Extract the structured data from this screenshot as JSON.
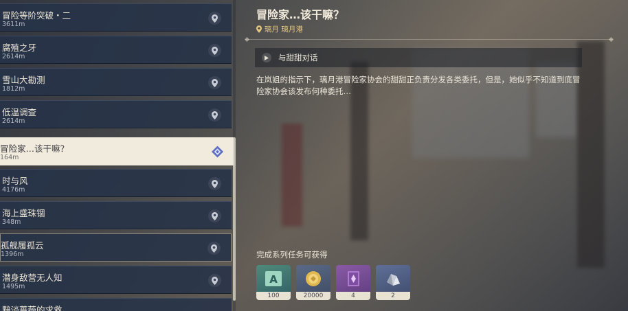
{
  "quests": [
    {
      "name": "冒险等阶突破・二",
      "distance": "3611m"
    },
    {
      "name": "腐殖之牙",
      "distance": "2614m"
    },
    {
      "name": "雪山大勘测",
      "distance": "1812m"
    },
    {
      "name": "低温调查",
      "distance": "2614m"
    },
    {
      "name": "冒险家…该干嘛？",
      "distance": "164m"
    },
    {
      "name": "时与风",
      "distance": "4176m"
    },
    {
      "name": "海上盛珠锢",
      "distance": "348m"
    },
    {
      "name": "孤舰履孤云",
      "distance": "1396m"
    },
    {
      "name": "潜身敌营无人知",
      "distance": "1495m"
    },
    {
      "name": "黯淡蔷薇的求救",
      "distance": ""
    }
  ],
  "detail": {
    "title": "冒险家…该干嘛？",
    "location": "璃月 璃月港",
    "step": "与甜甜对话",
    "description": "在岚姐的指示下，璃月港冒险家协会的甜甜正负责分发各类委托，但是，她似乎不知道到底冒险家协会该发布何种委托…",
    "rewards_title": "完成系列任务可获得",
    "rewards": [
      {
        "icon": "adventure-exp-icon",
        "count": "100"
      },
      {
        "icon": "mora-coin-icon",
        "count": "20000"
      },
      {
        "icon": "heros-wit-book-icon",
        "count": "4"
      },
      {
        "icon": "enhancement-ore-icon",
        "count": "2"
      }
    ]
  },
  "colors": {
    "list_bg": "#263248",
    "selected_bg": "#f1ebdd",
    "location_gold": "#e3c67f",
    "text_light": "#ece6d8"
  }
}
